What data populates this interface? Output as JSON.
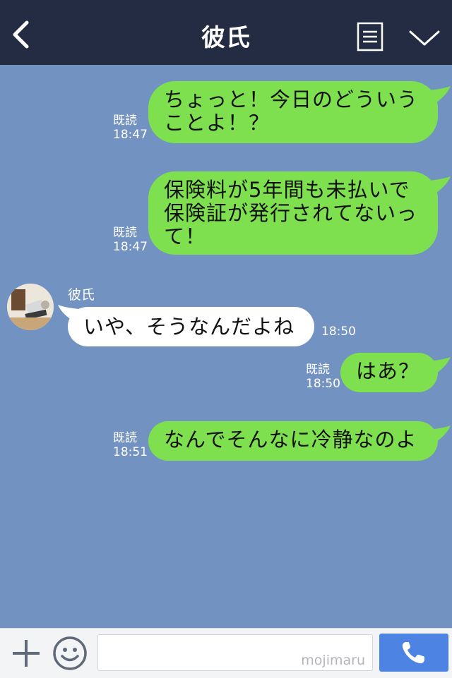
{
  "header": {
    "title": "彼氏",
    "back_icon": "chevron-left-icon",
    "notes_icon": "notes-icon",
    "menu_icon": "chevron-down-icon"
  },
  "messages": [
    {
      "direction": "out",
      "lines": [
        "ちょっと！今日のどういう",
        "ことよ！？"
      ],
      "read": "既読",
      "time": "18:47"
    },
    {
      "direction": "out",
      "lines": [
        "保険料が5年間も未払いで",
        "保険証が発行されてないっ",
        "て！"
      ],
      "read": "既読",
      "time": "18:47"
    },
    {
      "direction": "in",
      "sender": "彼氏",
      "lines": [
        "いや、そうなんだよね"
      ],
      "time": "18:50"
    },
    {
      "direction": "out",
      "lines": [
        "はあ？"
      ],
      "read": "既読",
      "time": "18:50"
    },
    {
      "direction": "out",
      "lines": [
        "なんでそんなに冷静なのよ"
      ],
      "read": "既読",
      "time": "18:51"
    }
  ],
  "footer": {
    "plus_icon": "plus-icon",
    "emoji_icon": "smiley-icon",
    "input_value": "",
    "watermark": "mojimaru",
    "call_icon": "phone-icon"
  },
  "colors": {
    "header_bg": "#232c42",
    "chat_bg": "#7293c1",
    "outgoing_bubble": "#7ee04e",
    "incoming_bubble": "#ffffff",
    "call_button": "#4d84e4"
  }
}
